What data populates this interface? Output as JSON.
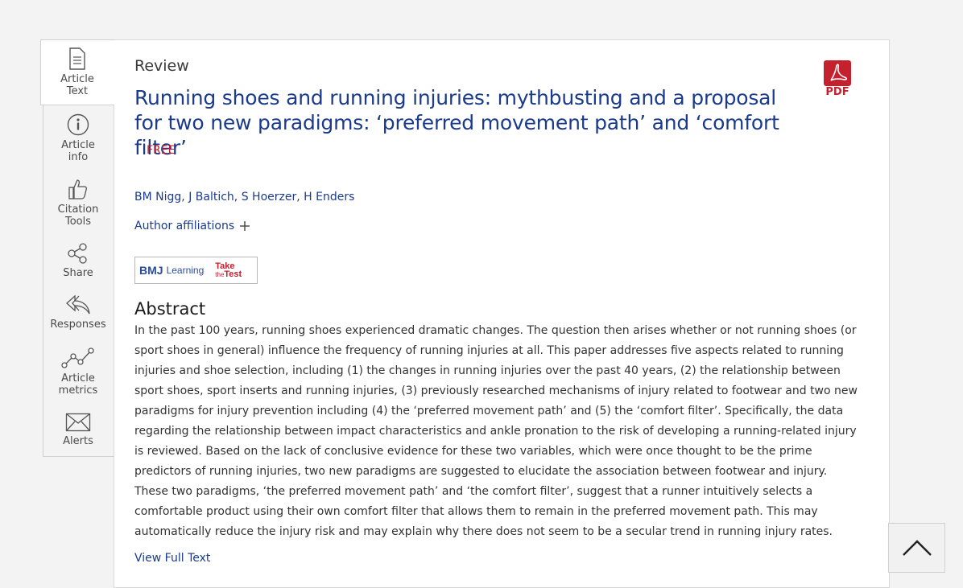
{
  "sidebar": {
    "items": [
      {
        "line1": "Article",
        "line2": "Text",
        "icon": "document-icon"
      },
      {
        "line1": "Article",
        "line2": "info",
        "icon": "info-icon"
      },
      {
        "line1": "Citation",
        "line2": "Tools",
        "icon": "thumbs-up-icon"
      },
      {
        "line1": "Share",
        "line2": "",
        "icon": "share-icon"
      },
      {
        "line1": "Responses",
        "line2": "",
        "icon": "reply-icon"
      },
      {
        "line1": "Article",
        "line2": "metrics",
        "icon": "metrics-icon"
      },
      {
        "line1": "Alerts",
        "line2": "",
        "icon": "envelope-icon"
      }
    ]
  },
  "article": {
    "type": "Review",
    "title": "Running shoes and running injuries: mythbusting and a proposal for two new paradigms: ‘preferred movement path’ and ‘comfort filter’",
    "access": "FREE",
    "authors": [
      "BM Nigg",
      "J Baltich",
      "S Hoerzer",
      "H Enders"
    ],
    "affiliations_label": "Author affiliations",
    "bmj": {
      "logo": "BMJ",
      "learning": "Learning",
      "take": "Take",
      "the": "the",
      "test": "Test"
    },
    "abstract_heading": "Abstract",
    "abstract": "In the past 100 years, running shoes experienced dramatic changes. The question then arises whether or not running shoes (or sport shoes in general) influence the frequency of running injuries at all. This paper addresses five aspects related to running injuries and shoe selection, including (1) the changes in running injuries over the past 40 years, (2) the relationship between sport shoes, sport inserts and running injuries, (3) previously researched mechanisms of injury related to footwear and two new paradigms for injury prevention including (4) the ‘preferred movement path’ and (5) the ‘comfort filter’. Specifically, the data regarding the relationship between impact characteristics and ankle pronation to the risk of developing a running-related injury is reviewed. Based on the lack of conclusive evidence for these two variables, which were once thought to be the prime predictors of running injuries, two new paradigms are suggested to elucidate the association between footwear and injury. These two paradigms, ‘the preferred movement path’ and ‘the comfort filter’, suggest that a runner intuitively selects a comfortable product using their own comfort filter that allows them to remain in the preferred movement path. This may automatically reduce the injury risk and may explain why there does not seem to be a secular trend in running injury rates.",
    "view_full_text": "View Full Text"
  },
  "pdf_label": "PDF",
  "colors": {
    "link": "#1a3a8c",
    "accent_red": "#c4202d"
  }
}
